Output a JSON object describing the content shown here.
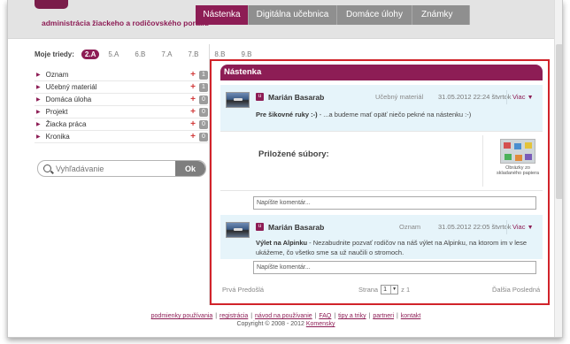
{
  "header": {
    "subtitle": "administrácia žiackeho a rodičovského portálu",
    "tabs": [
      "Nástenka",
      "Digitálna učebnica",
      "Domáce úlohy",
      "Známky"
    ]
  },
  "classes": {
    "label": "Moje triedy:",
    "items": [
      "2.A",
      "5.A",
      "6.B",
      "7.A",
      "7.B",
      "8.B",
      "9.B"
    ]
  },
  "sidebar": {
    "items": [
      {
        "label": "Oznam",
        "count": "1"
      },
      {
        "label": "Učebný materiál",
        "count": "1"
      },
      {
        "label": "Domáca úloha",
        "count": "0"
      },
      {
        "label": "Projekt",
        "count": "0"
      },
      {
        "label": "Žiacka práca",
        "count": "0"
      },
      {
        "label": "Kronika",
        "count": "0"
      }
    ],
    "plus_symbol": "+"
  },
  "search": {
    "placeholder": "Vyhľadávanie",
    "button": "Ok"
  },
  "panel": {
    "title": "Nástenka"
  },
  "posts": [
    {
      "badge": "u",
      "author": "Marián Basarab",
      "category": "Učebný materiál",
      "date": "31.05.2012 22:24 štvrtok",
      "more": "Viac",
      "title": "Pre šikovné ruky :-)",
      "text": " - ...a budeme mať opäť niečo pekné na nástenku :-)",
      "attachments_label": "Priložené súbory:",
      "attachment_caption": "Obrázky zo skladaného papiera",
      "comment_placeholder": "Napíšte komentár..."
    },
    {
      "badge": "u",
      "author": "Marián Basarab",
      "category": "Oznam",
      "date": "31.05.2012 22:05 štvrtok",
      "more": "Viac",
      "title": "Výlet na Alpinku",
      "text": " - Nezabudnite pozvať rodičov na náš výlet na Alpinku, na ktorom im v lese ukážeme, čo všetko sme sa už naučili o stromoch.",
      "comment_placeholder": "Napíšte komentár..."
    }
  ],
  "pager": {
    "prev": "Prvá Predošlá",
    "page_label": "Strana",
    "page_value": "1",
    "of_label": "z 1",
    "next": "Ďalšia Posledná"
  },
  "footer": {
    "links": [
      "podmienky používania",
      "registrácia",
      "návod na používanie",
      "FAQ",
      "tipy a triky",
      "partneri",
      "kontakt"
    ],
    "copyright": "Copyright © 2008 - 2012",
    "brand": "Komensky"
  },
  "colors": {
    "brand": "#8d1d55",
    "highlight_border": "#d1232a",
    "post_bg": "#e6f4fa"
  }
}
